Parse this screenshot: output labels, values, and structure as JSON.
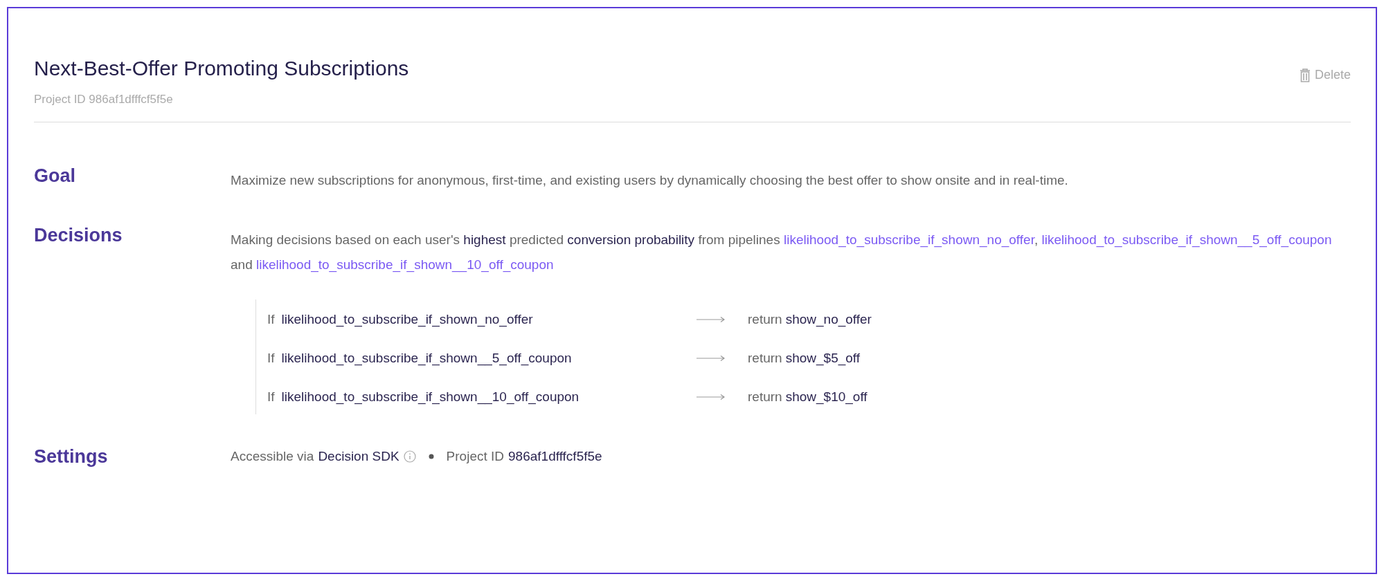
{
  "header": {
    "title": "Next-Best-Offer Promoting Subscriptions",
    "project_id": "Project ID 986af1dfffcf5f5e",
    "delete_button": "Delete"
  },
  "sections": [
    {
      "kind": "goal",
      "label": "Goal",
      "text": "Maximize new subscriptions for anonymous, first-time, and existing users by dynamically choosing the best offer to show onsite and in real-time."
    },
    {
      "kind": "decisions",
      "label": "Decisions",
      "segments": [
        {
          "kind": "plain",
          "text": "Making decisions based on each user's "
        },
        {
          "kind": "strong",
          "text": "highest"
        },
        {
          "kind": "plain",
          "text": " predicted "
        },
        {
          "kind": "strong",
          "text": "conversion probability"
        },
        {
          "kind": "plain",
          "text": " from pipelines "
        },
        {
          "kind": "link",
          "text": "likelihood_to_subscribe_if_shown_no_offer"
        },
        {
          "kind": "plain",
          "text": ", "
        },
        {
          "kind": "link",
          "text": "likelihood_to_subscribe_if_shown__5_off_coupon"
        },
        {
          "kind": "plain",
          "text": " and "
        },
        {
          "kind": "link",
          "text": "likelihood_to_subscribe_if_shown__10_off_coupon"
        }
      ],
      "rules": [
        {
          "if_label": "If",
          "pipeline": "likelihood_to_subscribe_if_shown_no_offer",
          "return_label": "return",
          "value": "show_no_offer"
        },
        {
          "if_label": "If",
          "pipeline": "likelihood_to_subscribe_if_shown__5_off_coupon",
          "return_label": "return",
          "value": "show_$5_off"
        },
        {
          "if_label": "If",
          "pipeline": "likelihood_to_subscribe_if_shown__10_off_coupon",
          "return_label": "return",
          "value": "show_$10_off"
        }
      ]
    },
    {
      "kind": "settings",
      "label": "Settings",
      "access_label": "Accessible via",
      "access_value": "Decision SDK",
      "id_label": "Project ID",
      "id_value": "986af1dfffcf5f5e"
    }
  ]
}
